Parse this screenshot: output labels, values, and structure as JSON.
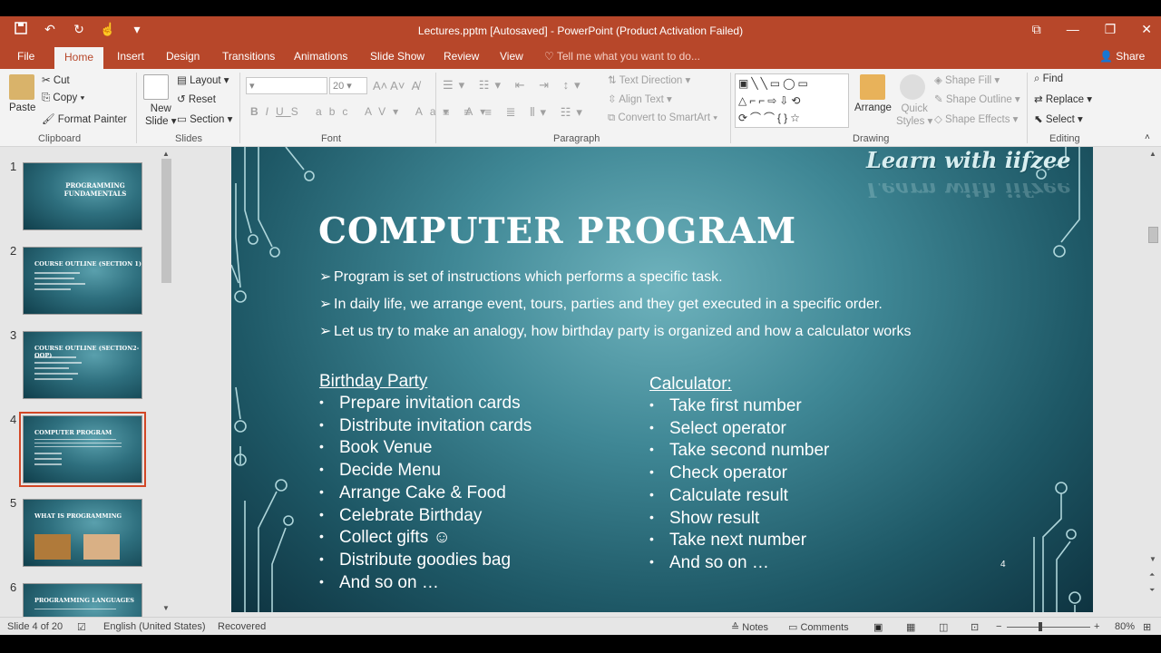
{
  "window": {
    "title": "Lectures.pptm [Autosaved] - PowerPoint (Product Activation Failed)",
    "accent": "#b7472a"
  },
  "qat": {
    "save_icon": "save-icon",
    "undo_icon": "undo-icon",
    "redo_icon": "repeat-icon"
  },
  "tabs": [
    "File",
    "Home",
    "Insert",
    "Design",
    "Transitions",
    "Animations",
    "Slide Show",
    "Review",
    "View"
  ],
  "tell_me": "Tell me what you want to do...",
  "share_label": "Share",
  "ribbon": {
    "clipboard": {
      "paste": "Paste",
      "cut": "Cut",
      "copy": "Copy",
      "format_painter": "Format Painter",
      "label": "Clipboard"
    },
    "slides": {
      "new_slide_line1": "New",
      "new_slide_line2": "Slide",
      "layout": "Layout",
      "reset": "Reset",
      "section": "Section",
      "label": "Slides"
    },
    "font": {
      "size": "20",
      "label": "Font"
    },
    "paragraph": {
      "text_direction": "Text Direction",
      "align_text": "Align Text",
      "convert_smartart": "Convert to SmartArt",
      "label": "Paragraph"
    },
    "drawing": {
      "arrange": "Arrange",
      "quick_styles_line1": "Quick",
      "quick_styles_line2": "Styles",
      "shape_fill": "Shape Fill",
      "shape_outline": "Shape Outline",
      "shape_effects": "Shape Effects",
      "label": "Drawing"
    },
    "editing": {
      "find": "Find",
      "replace": "Replace",
      "select": "Select",
      "label": "Editing"
    }
  },
  "thumbnails": [
    {
      "num": "1",
      "title": "PROGRAMMING FUNDAMENTALS"
    },
    {
      "num": "2",
      "title": "COURSE OUTLINE (SECTION 1)"
    },
    {
      "num": "3",
      "title": "COURSE OUTLINE (SECTION2- OOP)"
    },
    {
      "num": "4",
      "title": "COMPUTER PROGRAM"
    },
    {
      "num": "5",
      "title": "WHAT IS PROGRAMMING"
    },
    {
      "num": "6",
      "title": "PROGRAMMING LANGUAGES"
    }
  ],
  "slide": {
    "brand": "Learn with iifzee",
    "title": "COMPUTER PROGRAM",
    "points": [
      "Program is set of instructions which performs a specific task.",
      "In daily life, we arrange event, tours, parties and they get executed in a specific order.",
      "Let us try to make an analogy, how birthday party is organized and how a calculator works"
    ],
    "left_heading": "Birthday Party",
    "left_items": [
      "Prepare invitation cards",
      "Distribute invitation cards",
      "Book Venue",
      "Decide Menu",
      "Arrange Cake & Food",
      "Celebrate Birthday",
      "Collect gifts ☺",
      "Distribute goodies bag",
      "And so on …"
    ],
    "right_heading": "Calculator:",
    "right_items": [
      "Take first number",
      "Select operator",
      "Take second number",
      "Check operator",
      "Calculate result",
      "Show result",
      "Take next number",
      "And so on …"
    ],
    "number": "4"
  },
  "status": {
    "slide_of": "Slide 4 of 20",
    "language": "English (United States)",
    "recovered": "Recovered",
    "notes": "Notes",
    "comments": "Comments",
    "zoom": "80%"
  }
}
